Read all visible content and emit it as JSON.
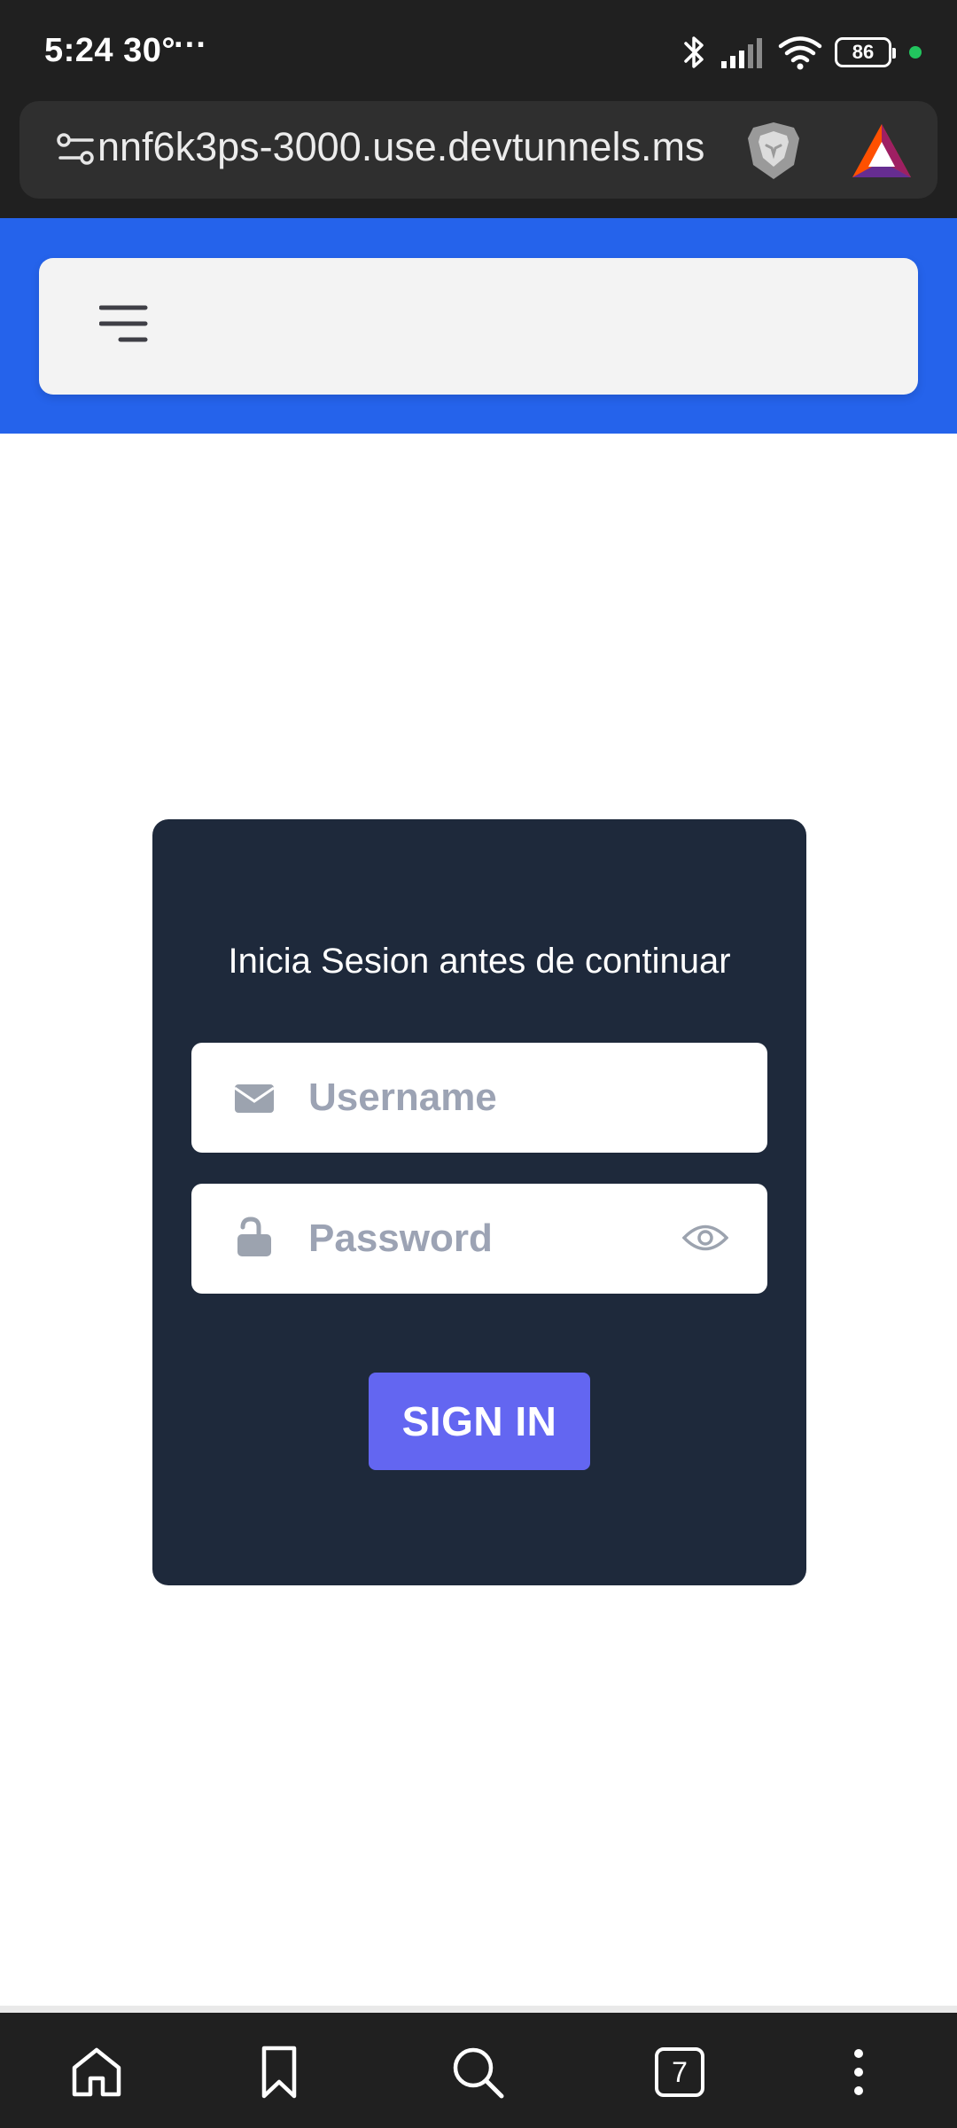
{
  "status_bar": {
    "time": "5:24",
    "temperature": "30°",
    "overflow": "···",
    "battery": "86",
    "icons": [
      "bluetooth-icon",
      "cellular-signal-icon",
      "wifi-icon",
      "battery-icon",
      "privacy-indicator-dot"
    ]
  },
  "browser": {
    "url": "nnf6k3ps-3000.use.devtunnels.ms",
    "icons": [
      "site-settings-icon",
      "brave-shields-icon",
      "brave-rewards-icon"
    ]
  },
  "navbar": {
    "menu_icon": "hamburger-menu-icon"
  },
  "login": {
    "heading": "Inicia Sesion antes de continuar",
    "username_placeholder": "Username",
    "username_value": "",
    "password_placeholder": "Password",
    "password_value": "",
    "signin_label": "SIGN IN"
  },
  "bottom_bar": {
    "tab_count": "7",
    "icons": [
      "home-icon",
      "bookmark-icon",
      "search-icon",
      "tabs-icon",
      "more-options-icon"
    ]
  },
  "colors": {
    "header_blue": "#2563eb",
    "card_bg": "#1e293b",
    "button_indigo": "#6366f1",
    "browser_chrome": "#202020",
    "status_dot_green": "#22c55e"
  }
}
